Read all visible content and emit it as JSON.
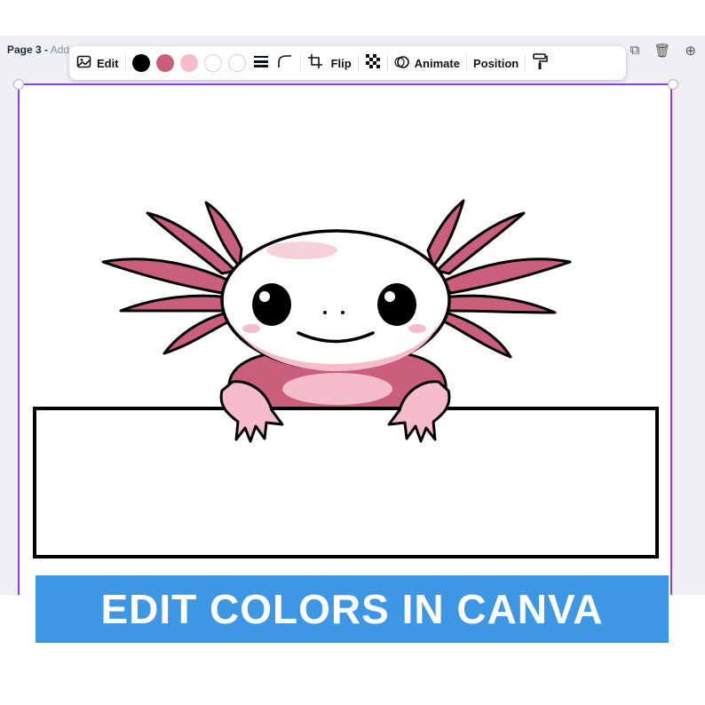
{
  "header": {
    "page_label": "Page 3 -",
    "page_add": "Add"
  },
  "toolbar": {
    "edit_label": "Edit",
    "flip_label": "Flip",
    "animate_label": "Animate",
    "position_label": "Position",
    "swatches": [
      "#000000",
      "#c95f7b",
      "#f4bdc9",
      "#ffffff",
      "#ffffff"
    ]
  },
  "banner": {
    "text": "EDIT COLORS IN CANVA",
    "color": "#3d97e4"
  },
  "icons": {
    "edit": "image-edit-icon",
    "lines": "line-weight-icon",
    "corner": "corner-rounding-icon",
    "crop": "crop-icon",
    "transparency": "transparency-icon",
    "animate": "animate-icon",
    "paint": "paint-roller-icon"
  }
}
